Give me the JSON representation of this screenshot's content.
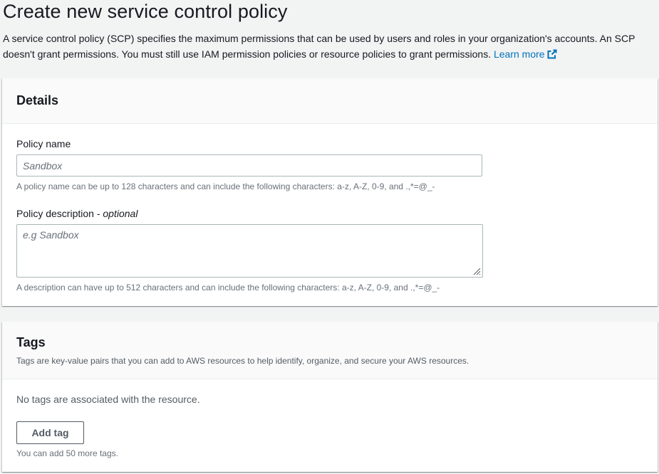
{
  "page": {
    "title": "Create new service control policy",
    "description": "A service control policy (SCP) specifies the maximum permissions that can be used by users and roles in your organization's accounts. An SCP doesn't grant permissions. You must still use IAM permission policies or resource policies to grant permissions.",
    "learn_more": "Learn more",
    "link_color": "#0073bb"
  },
  "details": {
    "title": "Details",
    "policy_name": {
      "label": "Policy name",
      "value": "",
      "placeholder": "Sandbox",
      "hint": "A policy name can be up to 128 characters and can include the following characters: a-z, A-Z, 0-9, and .,*=@_-"
    },
    "policy_description": {
      "label": "Policy description",
      "optional": "optional",
      "separator": " - ",
      "value": "",
      "placeholder": "e.g Sandbox",
      "hint": "A description can have up to 512 characters and can include the following characters: a-z, A-Z, 0-9, and .,*=@_-"
    }
  },
  "tags": {
    "title": "Tags",
    "description": "Tags are key-value pairs that you can add to AWS resources to help identify, organize, and secure your AWS resources.",
    "empty_text": "No tags are associated with the resource.",
    "add_button": "Add tag",
    "limit_hint": "You can add 50 more tags."
  },
  "icons": {
    "external_link": "external-link-icon",
    "resize_grip": "resize-grip-icon"
  }
}
